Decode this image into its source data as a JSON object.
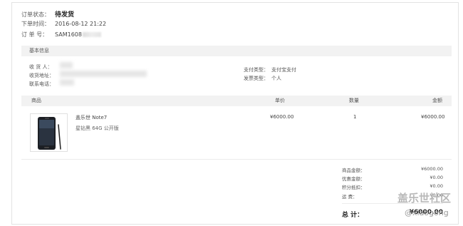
{
  "order": {
    "status_label": "订单状态：",
    "status_value": "待发货",
    "time_label": "下单时间：",
    "time_value": "2016-08-12 21:22",
    "number_label": "订 单 号：",
    "number_value": "SAM1608"
  },
  "basic_info": {
    "header": "基本信息",
    "receiver_label": "收 货 人：",
    "address_label": "收货地址：",
    "phone_label": "联系电话：",
    "payment_type_label": "支付类型：",
    "payment_type_value": "支付宝支付",
    "invoice_type_label": "发票类型：",
    "invoice_type_value": "个人"
  },
  "products": {
    "headers": {
      "product": "商品",
      "unit_price": "单价",
      "quantity": "数量",
      "amount": "金额"
    },
    "items": [
      {
        "image_icon": "phone-image-icon",
        "name": "盖乐世 Note7",
        "spec": "星钻黑  64G  公开版",
        "unit_price": "¥6000.00",
        "quantity": "1",
        "amount": "¥6000.00"
      }
    ]
  },
  "summary": {
    "goods_amount_label": "商品金额：",
    "goods_amount": "¥6000.00",
    "discount_label": "优惠金额：",
    "discount": "¥0.00",
    "points_label": "积分抵扣：",
    "points": "¥0.00",
    "shipping_label": "运    费：",
    "shipping": "¥0.00",
    "total_label": "总  计：",
    "total": "¥6000.00"
  },
  "watermark": {
    "main": "盖乐世社区",
    "sub": "@xiaogong"
  }
}
